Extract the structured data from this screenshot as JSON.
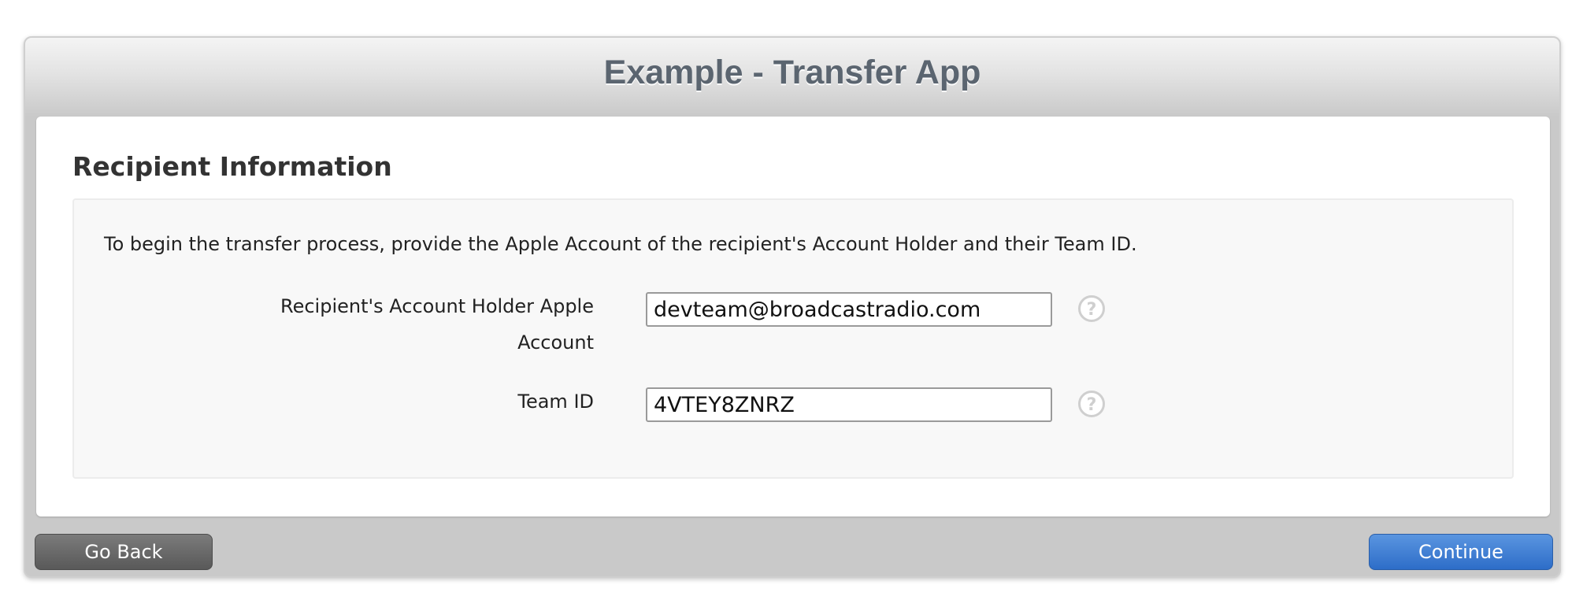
{
  "app": {
    "title": "Example - Transfer App"
  },
  "section": {
    "title": "Recipient Information",
    "intro": "To begin the transfer process, provide the Apple Account of the recipient's Account Holder and their Team ID."
  },
  "fields": {
    "apple_account": {
      "label_line1": "Recipient's Account Holder Apple",
      "label_line2": "Account",
      "value": "devteam@broadcastradio.com",
      "help_icon": "question-circle-icon"
    },
    "team_id": {
      "label": "Team ID",
      "value": "4VTEY8ZNRZ",
      "help_icon": "question-circle-icon"
    }
  },
  "buttons": {
    "back_label": "Go Back",
    "continue_label": "Continue"
  },
  "colors": {
    "title_text": "#5b6570",
    "continue_button": "#2d6dc8",
    "back_button": "#595959"
  }
}
